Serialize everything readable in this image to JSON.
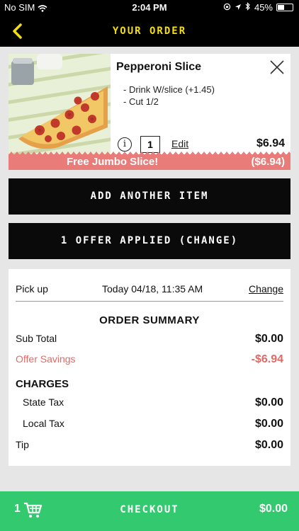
{
  "status_bar": {
    "carrier": "No SIM",
    "time": "2:04 PM",
    "battery": "45%",
    "battery_level": 0.45
  },
  "header": {
    "title": "YOUR ORDER",
    "accent_color": "#f3df0f"
  },
  "item": {
    "name": "Pepperoni Slice",
    "modifiers": [
      "- Drink W/slice (+1.45)",
      "- Cut 1/2"
    ],
    "quantity": "1",
    "edit_label": "Edit",
    "price": "$6.94",
    "promo_label": "Free Jumbo Slice!",
    "promo_amount": "($6.94)",
    "promo_color": "#e97b79"
  },
  "buttons": {
    "add_item": "ADD ANOTHER ITEM",
    "offer": "1 OFFER APPLIED (CHANGE)"
  },
  "pickup": {
    "label": "Pick up",
    "when": "Today 04/18, 11:35 AM",
    "change_label": "Change"
  },
  "summary": {
    "title": "ORDER SUMMARY",
    "subtotal_label": "Sub Total",
    "subtotal": "$0.00",
    "savings_label": "Offer Savings",
    "savings": "-$6.94",
    "charges_title": "CHARGES",
    "state_tax_label": "State Tax",
    "state_tax": "$0.00",
    "local_tax_label": "Local Tax",
    "local_tax": "$0.00",
    "tip_label": "Tip",
    "tip": "$0.00"
  },
  "checkout": {
    "count": "1",
    "label": "CHECKOUT",
    "total": "$0.00",
    "color": "#33c96e"
  }
}
